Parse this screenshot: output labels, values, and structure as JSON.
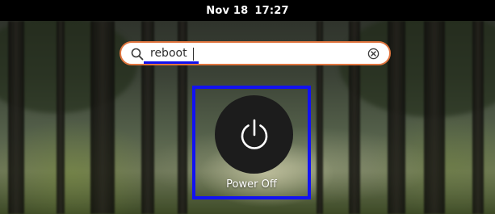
{
  "topbar": {
    "date": "Nov 18",
    "time": "17:27"
  },
  "search": {
    "value": "reboot",
    "icon": "search-icon",
    "clear_icon": "clear-icon",
    "border_color": "#e0753f"
  },
  "results": [
    {
      "label": "Power Off",
      "icon": "power-icon",
      "highlight_color": "#1212f2"
    }
  ]
}
